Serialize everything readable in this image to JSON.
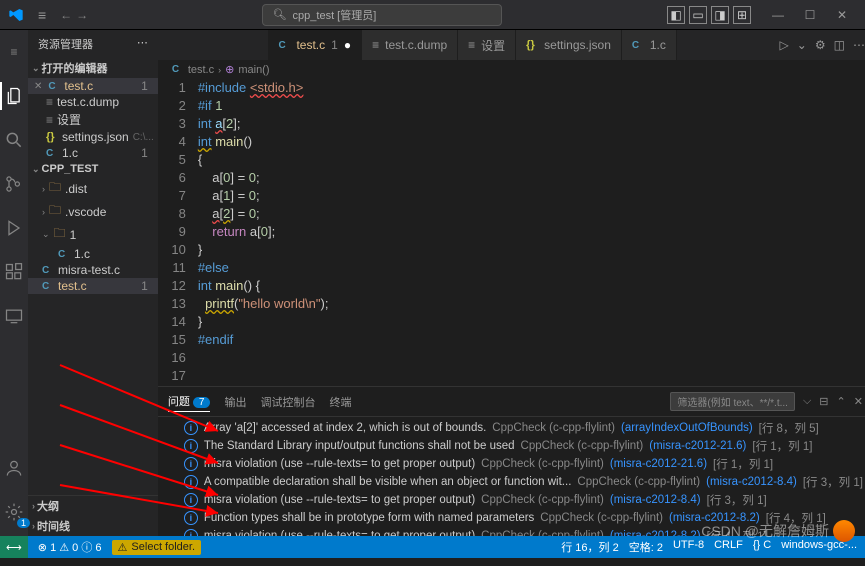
{
  "title_bar": {
    "search_label": "cpp_test [管理员]",
    "history_back": "←",
    "history_fwd": "→"
  },
  "sidebar": {
    "title": "资源管理器",
    "open_editors": "打开的编辑器",
    "project": "CPP_TEST",
    "items": [
      {
        "icon": "C",
        "label": "test.c",
        "badge": "1",
        "mod": true,
        "close": true
      },
      {
        "icon": "≡",
        "label": "test.c.dump"
      },
      {
        "icon": "≡",
        "label": "设置"
      },
      {
        "icon": "{}",
        "label": "settings.json",
        "hint": "C:\\..."
      },
      {
        "icon": "C",
        "label": "1.c",
        "badge": "1"
      }
    ],
    "tree": [
      {
        "type": "folder",
        "label": ".dist",
        "chev": "›"
      },
      {
        "type": "folder",
        "label": ".vscode",
        "chev": "›"
      },
      {
        "type": "folder",
        "label": "1",
        "chev": "⌄"
      },
      {
        "type": "file",
        "icon": "C",
        "label": "1.c",
        "indent": true
      },
      {
        "type": "file",
        "icon": "C",
        "label": "misra-test.c"
      },
      {
        "type": "file",
        "icon": "C",
        "label": "test.c",
        "badge": "1",
        "mod": true,
        "active": true
      }
    ],
    "outline": "大纲",
    "timeline": "时间线"
  },
  "editor": {
    "tabs": [
      {
        "icon": "C",
        "label": "test.c",
        "badge": "1",
        "mod": true,
        "dirty": "●",
        "active": true
      },
      {
        "icon": "≡",
        "label": "test.c.dump"
      },
      {
        "icon": "≡",
        "label": "设置"
      },
      {
        "icon": "{}",
        "label": "settings.json"
      },
      {
        "icon": "C",
        "label": "1.c"
      }
    ],
    "breadcrumb": [
      "test.c",
      "main()"
    ],
    "code": [
      {
        "n": 1,
        "html": "<span class='c-pp'>#include</span> <span class='c-str c-err'>&lt;stdio.h&gt;</span>"
      },
      {
        "n": 2,
        "html": "<span class='c-pp'>#if</span> <span class='c-num'>1</span>"
      },
      {
        "n": 3,
        "html": "<span class='c-ty'>int</span> <span class='c-var c-err'>a</span>[<span class='c-num'>2</span>];"
      },
      {
        "n": 4,
        "html": "<span class='c-ty c-warn'>int</span> <span class='c-fn'>main</span>()"
      },
      {
        "n": 5,
        "html": "{"
      },
      {
        "n": 6,
        "html": "    a[<span class='c-num'>0</span>] = <span class='c-num'>0</span>;"
      },
      {
        "n": 7,
        "html": "    a[<span class='c-num'>1</span>] = <span class='c-num'>0</span>;"
      },
      {
        "n": 8,
        "html": "    <span class='c-err'>a</span>[<span class='c-num c-warn'>2</span>] = <span class='c-num'>0</span>;"
      },
      {
        "n": 9,
        "html": ""
      },
      {
        "n": 10,
        "html": "    <span class='c-kw'>return</span> a[<span class='c-num'>0</span>];"
      },
      {
        "n": 11,
        "html": "}"
      },
      {
        "n": 12,
        "html": "<span class='c-pp'>#else</span>"
      },
      {
        "n": 13,
        "html": ""
      },
      {
        "n": 14,
        "html": "<span class='c-ty'>int</span> <span class='c-fn'>main</span>() {"
      },
      {
        "n": 15,
        "html": "  <span class='c-fn c-warn'>printf</span>(<span class='c-str'>\"hello world\\n\"</span>);"
      },
      {
        "n": 16,
        "html": "}"
      },
      {
        "n": 17,
        "html": "<span class='c-pp'>#endif</span>"
      }
    ]
  },
  "panel": {
    "tabs": {
      "problems": "问题",
      "problems_count": "7",
      "output": "输出",
      "debug": "调试控制台",
      "terminal": "终端"
    },
    "filter_placeholder": "筛选器(例如 text、**/*.t...",
    "problems": [
      {
        "msg": "Array 'a[2]' accessed at index 2, which is out of bounds.",
        "src": "CppCheck (c-cpp-flylint)",
        "link": "(arrayIndexOutOfBounds)",
        "loc": "[行 8，列 5]"
      },
      {
        "msg": "The Standard Library input/output functions shall not be used",
        "src": "CppCheck (c-cpp-flylint)",
        "link": "(misra-c2012-21.6)",
        "loc": "[行 1，列 1]"
      },
      {
        "msg": "misra violation (use --rule-texts=<file> to get proper output)",
        "src": "CppCheck (c-cpp-flylint)",
        "link": "(misra-c2012-21.6)",
        "loc": "[行 1，列 1]"
      },
      {
        "msg": "A compatible declaration shall be visible when an object or function wit...",
        "src": "CppCheck (c-cpp-flylint)",
        "link": "(misra-c2012-8.4)",
        "loc": "[行 3，列 1]"
      },
      {
        "msg": "misra violation (use --rule-texts=<file> to get proper output)",
        "src": "CppCheck (c-cpp-flylint)",
        "link": "(misra-c2012-8.4)",
        "loc": "[行 3，列 1]"
      },
      {
        "msg": "Function types shall be in prototype form with named parameters",
        "src": "CppCheck (c-cpp-flylint)",
        "link": "(misra-c2012-8.2)",
        "loc": "[行 4，列 1]"
      },
      {
        "msg": "misra violation (use --rule-texts=<file> to get proper output)",
        "src": "CppCheck (c-cpp-flylint)",
        "link": "(misra-c2012-8.2)",
        "loc": "[行 4，列 1]"
      }
    ]
  },
  "status": {
    "errors": "1",
    "warnings": "0",
    "info": "6",
    "select_folder": "Select folder.",
    "right": [
      "行 16，列 2",
      "空格: 2",
      "UTF-8",
      "CRLF",
      "{} C",
      "windows-gcc-..."
    ]
  },
  "watermark": "CSDN @无解詹姆斯"
}
